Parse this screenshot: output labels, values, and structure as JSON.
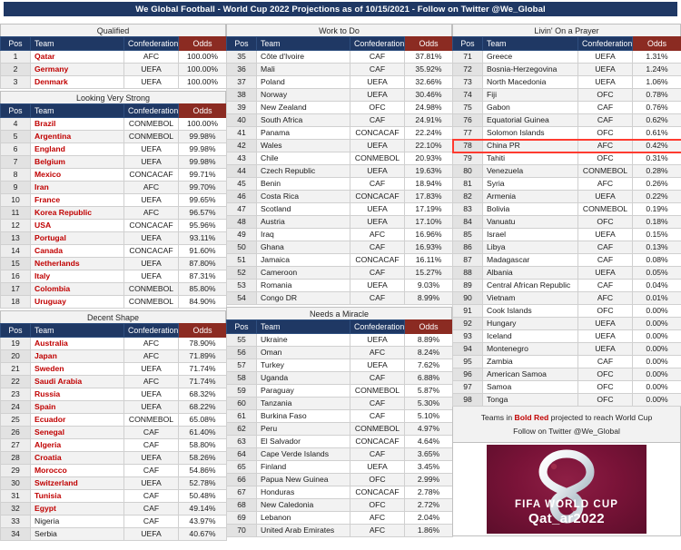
{
  "title": "We Global Football - World Cup 2022 Projections as of 10/15/2021 - Follow on Twitter @We_Global",
  "colors": {
    "header_navy": "#1F3864",
    "odds_header_red": "#8B2B22",
    "qualifier_red": "#C00000",
    "highlight_red": "#FF3B30",
    "band_gray": "#F2F2F2"
  },
  "columns": {
    "pos": "Pos",
    "team": "Team",
    "confederation": "Confederation",
    "odds": "Odds"
  },
  "sections": [
    {
      "id": "qualified",
      "title": "Qualified",
      "rows": [
        {
          "pos": "1",
          "team": "Qatar",
          "conf": "AFC",
          "odds": "100.00%",
          "bold_red": true
        },
        {
          "pos": "2",
          "team": "Germany",
          "conf": "UEFA",
          "odds": "100.00%",
          "bold_red": true
        },
        {
          "pos": "3",
          "team": "Denmark",
          "conf": "UEFA",
          "odds": "100.00%",
          "bold_red": true
        }
      ]
    },
    {
      "id": "looking-very-strong",
      "title": "Looking Very Strong",
      "rows": [
        {
          "pos": "4",
          "team": "Brazil",
          "conf": "CONMEBOL",
          "odds": "100.00%",
          "bold_red": true
        },
        {
          "pos": "5",
          "team": "Argentina",
          "conf": "CONMEBOL",
          "odds": "99.98%",
          "bold_red": true
        },
        {
          "pos": "6",
          "team": "England",
          "conf": "UEFA",
          "odds": "99.98%",
          "bold_red": true
        },
        {
          "pos": "7",
          "team": "Belgium",
          "conf": "UEFA",
          "odds": "99.98%",
          "bold_red": true
        },
        {
          "pos": "8",
          "team": "Mexico",
          "conf": "CONCACAF",
          "odds": "99.71%",
          "bold_red": true
        },
        {
          "pos": "9",
          "team": "Iran",
          "conf": "AFC",
          "odds": "99.70%",
          "bold_red": true
        },
        {
          "pos": "10",
          "team": "France",
          "conf": "UEFA",
          "odds": "99.65%",
          "bold_red": true
        },
        {
          "pos": "11",
          "team": "Korea Republic",
          "conf": "AFC",
          "odds": "96.57%",
          "bold_red": true
        },
        {
          "pos": "12",
          "team": "USA",
          "conf": "CONCACAF",
          "odds": "95.96%",
          "bold_red": true
        },
        {
          "pos": "13",
          "team": "Portugal",
          "conf": "UEFA",
          "odds": "93.11%",
          "bold_red": true
        },
        {
          "pos": "14",
          "team": "Canada",
          "conf": "CONCACAF",
          "odds": "91.60%",
          "bold_red": true
        },
        {
          "pos": "15",
          "team": "Netherlands",
          "conf": "UEFA",
          "odds": "87.80%",
          "bold_red": true
        },
        {
          "pos": "16",
          "team": "Italy",
          "conf": "UEFA",
          "odds": "87.31%",
          "bold_red": true
        },
        {
          "pos": "17",
          "team": "Colombia",
          "conf": "CONMEBOL",
          "odds": "85.80%",
          "bold_red": true
        },
        {
          "pos": "18",
          "team": "Uruguay",
          "conf": "CONMEBOL",
          "odds": "84.90%",
          "bold_red": true
        }
      ]
    },
    {
      "id": "decent-shape",
      "title": "Decent Shape",
      "rows": [
        {
          "pos": "19",
          "team": "Australia",
          "conf": "AFC",
          "odds": "78.90%",
          "bold_red": true
        },
        {
          "pos": "20",
          "team": "Japan",
          "conf": "AFC",
          "odds": "71.89%",
          "bold_red": true
        },
        {
          "pos": "21",
          "team": "Sweden",
          "conf": "UEFA",
          "odds": "71.74%",
          "bold_red": true
        },
        {
          "pos": "22",
          "team": "Saudi Arabia",
          "conf": "AFC",
          "odds": "71.74%",
          "bold_red": true
        },
        {
          "pos": "23",
          "team": "Russia",
          "conf": "UEFA",
          "odds": "68.32%",
          "bold_red": true
        },
        {
          "pos": "24",
          "team": "Spain",
          "conf": "UEFA",
          "odds": "68.22%",
          "bold_red": true
        },
        {
          "pos": "25",
          "team": "Ecuador",
          "conf": "CONMEBOL",
          "odds": "65.08%",
          "bold_red": true
        },
        {
          "pos": "26",
          "team": "Senegal",
          "conf": "CAF",
          "odds": "61.40%",
          "bold_red": true
        },
        {
          "pos": "27",
          "team": "Algeria",
          "conf": "CAF",
          "odds": "58.80%",
          "bold_red": true
        },
        {
          "pos": "28",
          "team": "Croatia",
          "conf": "UEFA",
          "odds": "58.26%",
          "bold_red": true
        },
        {
          "pos": "29",
          "team": "Morocco",
          "conf": "CAF",
          "odds": "54.86%",
          "bold_red": true
        },
        {
          "pos": "30",
          "team": "Switzerland",
          "conf": "UEFA",
          "odds": "52.78%",
          "bold_red": true
        },
        {
          "pos": "31",
          "team": "Tunisia",
          "conf": "CAF",
          "odds": "50.48%",
          "bold_red": true
        },
        {
          "pos": "32",
          "team": "Egypt",
          "conf": "CAF",
          "odds": "49.14%",
          "bold_red": true
        },
        {
          "pos": "33",
          "team": "Nigeria",
          "conf": "CAF",
          "odds": "43.97%",
          "bold_red": false
        },
        {
          "pos": "34",
          "team": "Serbia",
          "conf": "UEFA",
          "odds": "40.67%",
          "bold_red": false
        }
      ]
    },
    {
      "id": "work-to-do",
      "title": "Work to Do",
      "rows": [
        {
          "pos": "35",
          "team": "Côte d'Ivoire",
          "conf": "CAF",
          "odds": "37.81%",
          "bold_red": false
        },
        {
          "pos": "36",
          "team": "Mali",
          "conf": "CAF",
          "odds": "35.92%",
          "bold_red": false
        },
        {
          "pos": "37",
          "team": "Poland",
          "conf": "UEFA",
          "odds": "32.66%",
          "bold_red": false
        },
        {
          "pos": "38",
          "team": "Norway",
          "conf": "UEFA",
          "odds": "30.46%",
          "bold_red": false
        },
        {
          "pos": "39",
          "team": "New Zealand",
          "conf": "OFC",
          "odds": "24.98%",
          "bold_red": false
        },
        {
          "pos": "40",
          "team": "South Africa",
          "conf": "CAF",
          "odds": "24.91%",
          "bold_red": false
        },
        {
          "pos": "41",
          "team": "Panama",
          "conf": "CONCACAF",
          "odds": "22.24%",
          "bold_red": false
        },
        {
          "pos": "42",
          "team": "Wales",
          "conf": "UEFA",
          "odds": "22.10%",
          "bold_red": false
        },
        {
          "pos": "43",
          "team": "Chile",
          "conf": "CONMEBOL",
          "odds": "20.93%",
          "bold_red": false
        },
        {
          "pos": "44",
          "team": "Czech Republic",
          "conf": "UEFA",
          "odds": "19.63%",
          "bold_red": false
        },
        {
          "pos": "45",
          "team": "Benin",
          "conf": "CAF",
          "odds": "18.94%",
          "bold_red": false
        },
        {
          "pos": "46",
          "team": "Costa Rica",
          "conf": "CONCACAF",
          "odds": "17.83%",
          "bold_red": false
        },
        {
          "pos": "47",
          "team": "Scotland",
          "conf": "UEFA",
          "odds": "17.19%",
          "bold_red": false
        },
        {
          "pos": "48",
          "team": "Austria",
          "conf": "UEFA",
          "odds": "17.10%",
          "bold_red": false
        },
        {
          "pos": "49",
          "team": "Iraq",
          "conf": "AFC",
          "odds": "16.96%",
          "bold_red": false
        },
        {
          "pos": "50",
          "team": "Ghana",
          "conf": "CAF",
          "odds": "16.93%",
          "bold_red": false
        },
        {
          "pos": "51",
          "team": "Jamaica",
          "conf": "CONCACAF",
          "odds": "16.11%",
          "bold_red": false
        },
        {
          "pos": "52",
          "team": "Cameroon",
          "conf": "CAF",
          "odds": "15.27%",
          "bold_red": false
        },
        {
          "pos": "53",
          "team": "Romania",
          "conf": "UEFA",
          "odds": "9.03%",
          "bold_red": false
        },
        {
          "pos": "54",
          "team": "Congo DR",
          "conf": "CAF",
          "odds": "8.99%",
          "bold_red": false
        }
      ]
    },
    {
      "id": "needs-a-miracle",
      "title": "Needs a Miracle",
      "rows": [
        {
          "pos": "55",
          "team": "Ukraine",
          "conf": "UEFA",
          "odds": "8.89%",
          "bold_red": false
        },
        {
          "pos": "56",
          "team": "Oman",
          "conf": "AFC",
          "odds": "8.24%",
          "bold_red": false
        },
        {
          "pos": "57",
          "team": "Turkey",
          "conf": "UEFA",
          "odds": "7.62%",
          "bold_red": false
        },
        {
          "pos": "58",
          "team": "Uganda",
          "conf": "CAF",
          "odds": "6.88%",
          "bold_red": false
        },
        {
          "pos": "59",
          "team": "Paraguay",
          "conf": "CONMEBOL",
          "odds": "5.87%",
          "bold_red": false
        },
        {
          "pos": "60",
          "team": "Tanzania",
          "conf": "CAF",
          "odds": "5.30%",
          "bold_red": false
        },
        {
          "pos": "61",
          "team": "Burkina Faso",
          "conf": "CAF",
          "odds": "5.10%",
          "bold_red": false
        },
        {
          "pos": "62",
          "team": "Peru",
          "conf": "CONMEBOL",
          "odds": "4.97%",
          "bold_red": false
        },
        {
          "pos": "63",
          "team": "El Salvador",
          "conf": "CONCACAF",
          "odds": "4.64%",
          "bold_red": false
        },
        {
          "pos": "64",
          "team": "Cape Verde Islands",
          "conf": "CAF",
          "odds": "3.65%",
          "bold_red": false
        },
        {
          "pos": "65",
          "team": "Finland",
          "conf": "UEFA",
          "odds": "3.45%",
          "bold_red": false
        },
        {
          "pos": "66",
          "team": "Papua New Guinea",
          "conf": "OFC",
          "odds": "2.99%",
          "bold_red": false
        },
        {
          "pos": "67",
          "team": "Honduras",
          "conf": "CONCACAF",
          "odds": "2.78%",
          "bold_red": false
        },
        {
          "pos": "68",
          "team": "New Caledonia",
          "conf": "OFC",
          "odds": "2.72%",
          "bold_red": false
        },
        {
          "pos": "69",
          "team": "Lebanon",
          "conf": "AFC",
          "odds": "2.04%",
          "bold_red": false
        },
        {
          "pos": "70",
          "team": "United Arab Emirates",
          "conf": "AFC",
          "odds": "1.86%",
          "bold_red": false
        }
      ]
    },
    {
      "id": "livin-on-a-prayer",
      "title": "Livin' On a Prayer",
      "rows": [
        {
          "pos": "71",
          "team": "Greece",
          "conf": "UEFA",
          "odds": "1.31%",
          "bold_red": false
        },
        {
          "pos": "72",
          "team": "Bosnia-Herzegovina",
          "conf": "UEFA",
          "odds": "1.24%",
          "bold_red": false
        },
        {
          "pos": "73",
          "team": "North Macedonia",
          "conf": "UEFA",
          "odds": "1.06%",
          "bold_red": false
        },
        {
          "pos": "74",
          "team": "Fiji",
          "conf": "OFC",
          "odds": "0.78%",
          "bold_red": false
        },
        {
          "pos": "75",
          "team": "Gabon",
          "conf": "CAF",
          "odds": "0.76%",
          "bold_red": false
        },
        {
          "pos": "76",
          "team": "Equatorial Guinea",
          "conf": "CAF",
          "odds": "0.62%",
          "bold_red": false
        },
        {
          "pos": "77",
          "team": "Solomon Islands",
          "conf": "OFC",
          "odds": "0.61%",
          "bold_red": false
        },
        {
          "pos": "78",
          "team": "China PR",
          "conf": "AFC",
          "odds": "0.42%",
          "bold_red": false,
          "highlight": true
        },
        {
          "pos": "79",
          "team": "Tahiti",
          "conf": "OFC",
          "odds": "0.31%",
          "bold_red": false
        },
        {
          "pos": "80",
          "team": "Venezuela",
          "conf": "CONMEBOL",
          "odds": "0.28%",
          "bold_red": false
        },
        {
          "pos": "81",
          "team": "Syria",
          "conf": "AFC",
          "odds": "0.26%",
          "bold_red": false
        },
        {
          "pos": "82",
          "team": "Armenia",
          "conf": "UEFA",
          "odds": "0.22%",
          "bold_red": false
        },
        {
          "pos": "83",
          "team": "Bolivia",
          "conf": "CONMEBOL",
          "odds": "0.19%",
          "bold_red": false
        },
        {
          "pos": "84",
          "team": "Vanuatu",
          "conf": "OFC",
          "odds": "0.18%",
          "bold_red": false
        },
        {
          "pos": "85",
          "team": "Israel",
          "conf": "UEFA",
          "odds": "0.15%",
          "bold_red": false
        },
        {
          "pos": "86",
          "team": "Libya",
          "conf": "CAF",
          "odds": "0.13%",
          "bold_red": false
        },
        {
          "pos": "87",
          "team": "Madagascar",
          "conf": "CAF",
          "odds": "0.08%",
          "bold_red": false
        },
        {
          "pos": "88",
          "team": "Albania",
          "conf": "UEFA",
          "odds": "0.05%",
          "bold_red": false
        },
        {
          "pos": "89",
          "team": "Central African Republic",
          "conf": "CAF",
          "odds": "0.04%",
          "bold_red": false
        },
        {
          "pos": "90",
          "team": "Vietnam",
          "conf": "AFC",
          "odds": "0.01%",
          "bold_red": false
        },
        {
          "pos": "91",
          "team": "Cook Islands",
          "conf": "OFC",
          "odds": "0.00%",
          "bold_red": false
        },
        {
          "pos": "92",
          "team": "Hungary",
          "conf": "UEFA",
          "odds": "0.00%",
          "bold_red": false
        },
        {
          "pos": "93",
          "team": "Iceland",
          "conf": "UEFA",
          "odds": "0.00%",
          "bold_red": false
        },
        {
          "pos": "94",
          "team": "Montenegro",
          "conf": "UEFA",
          "odds": "0.00%",
          "bold_red": false
        },
        {
          "pos": "95",
          "team": "Zambia",
          "conf": "CAF",
          "odds": "0.00%",
          "bold_red": false
        },
        {
          "pos": "96",
          "team": "American Samoa",
          "conf": "OFC",
          "odds": "0.00%",
          "bold_red": false
        },
        {
          "pos": "97",
          "team": "Samoa",
          "conf": "OFC",
          "odds": "0.00%",
          "bold_red": false
        },
        {
          "pos": "98",
          "team": "Tonga",
          "conf": "OFC",
          "odds": "0.00%",
          "bold_red": false
        }
      ]
    }
  ],
  "notes": {
    "legend_prefix": "Teams in ",
    "legend_emphasis": "Bold Red",
    "legend_suffix": " projected to reach World Cup",
    "follow": "Follow on Twitter @We_Global"
  },
  "logo": {
    "line1": "FIFA WORLD CUP",
    "line2": "Qat_ar2022"
  },
  "layout": {
    "left_sections": [
      "qualified",
      "looking-very-strong",
      "decent-shape"
    ],
    "mid_sections": [
      "work-to-do",
      "needs-a-miracle"
    ],
    "right_sections": [
      "livin-on-a-prayer"
    ]
  }
}
